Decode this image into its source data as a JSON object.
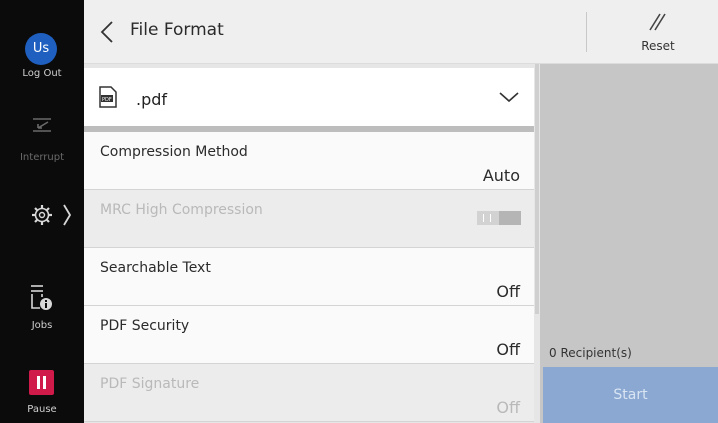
{
  "sidebar": {
    "avatar_initials": "Us",
    "logout_label": "Log Out",
    "interrupt_label": "Interrupt",
    "jobs_label": "Jobs",
    "pause_label": "Pause",
    "pause_color": "#cf1a4a",
    "avatar_color": "#1f5fbf"
  },
  "header": {
    "title": "File Format",
    "reset_label": "Reset"
  },
  "format": {
    "selected": ".pdf",
    "icon": "pdf-file-icon"
  },
  "rows": [
    {
      "label": "Compression Method",
      "value": "Auto",
      "enabled": true
    },
    {
      "label": "MRC High Compression",
      "value": "",
      "enabled": false,
      "control": "toggle"
    },
    {
      "label": "Searchable Text",
      "value": "Off",
      "enabled": true
    },
    {
      "label": "PDF Security",
      "value": "Off",
      "enabled": true
    },
    {
      "label": "PDF Signature",
      "value": "Off",
      "enabled": false
    }
  ],
  "panel": {
    "recipients": "0 Recipient(s)",
    "start_label": "Start",
    "start_color": "#8aa8d2"
  }
}
